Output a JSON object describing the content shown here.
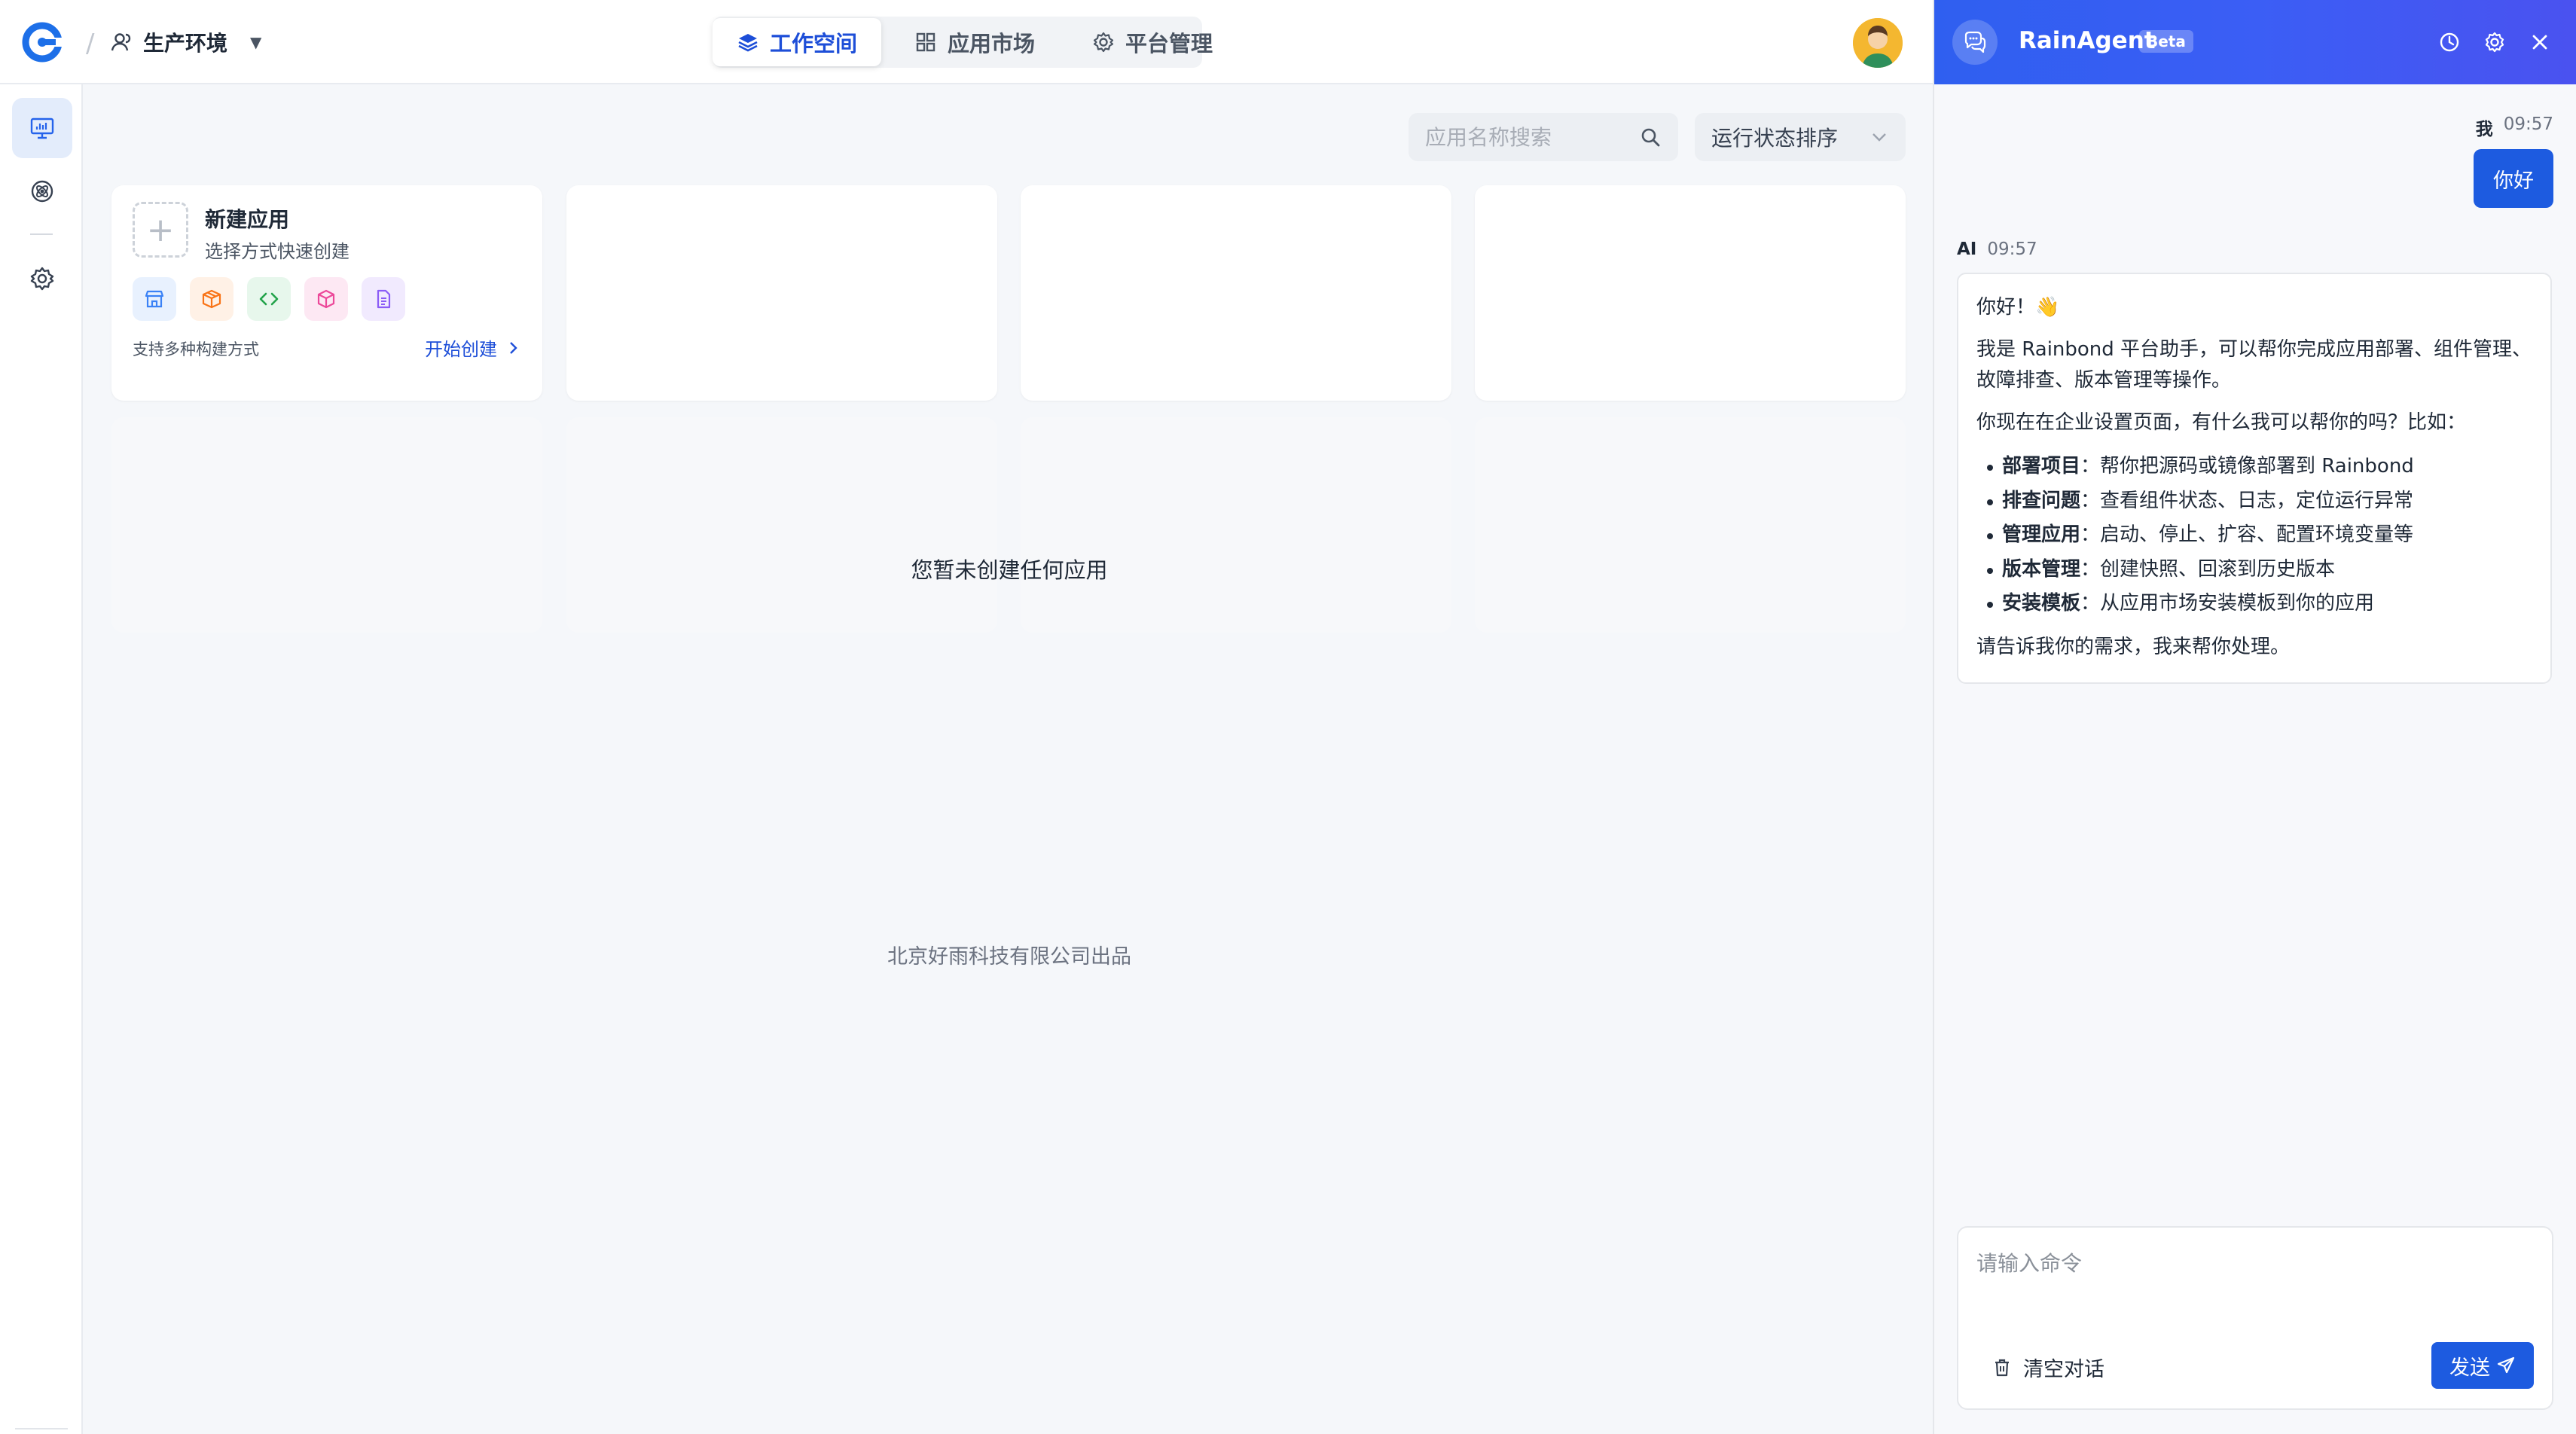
{
  "header": {
    "environment": "生产环境",
    "tabs": [
      {
        "label": "工作空间",
        "icon": "layers-icon",
        "active": true
      },
      {
        "label": "应用市场",
        "icon": "grid-icon",
        "active": false
      },
      {
        "label": "平台管理",
        "icon": "gear-icon",
        "active": false
      }
    ]
  },
  "sidebar": {
    "items": [
      {
        "icon": "monitor-icon",
        "active": true
      },
      {
        "icon": "atom-icon",
        "active": false
      },
      {
        "icon": "settings-icon",
        "active": false
      }
    ]
  },
  "toolbar": {
    "search_placeholder": "应用名称搜索",
    "sort_label": "运行状态排序"
  },
  "new_app_card": {
    "title": "新建应用",
    "subtitle": "选择方式快速创建",
    "support_text": "支持多种构建方式",
    "start_label": "开始创建",
    "build_icons": [
      {
        "icon": "store-icon",
        "color": "#3b82f6",
        "bg": "#e8f1fe"
      },
      {
        "icon": "package-icon",
        "color": "#f97316",
        "bg": "#fff1e6"
      },
      {
        "icon": "code-icon",
        "color": "#22a34a",
        "bg": "#e7f7ec"
      },
      {
        "icon": "cube-icon",
        "color": "#ec4899",
        "bg": "#fde8f3"
      },
      {
        "icon": "document-icon",
        "color": "#8b5cf6",
        "bg": "#f1eafe"
      }
    ]
  },
  "main": {
    "empty_text": "您暂未创建任何应用",
    "footer_text": "北京好雨科技有限公司出品"
  },
  "agent": {
    "name": "RainAgent",
    "badge": "Beta",
    "user_message": {
      "sender": "我",
      "time": "09:57",
      "text": "你好"
    },
    "ai_message": {
      "sender": "AI",
      "time": "09:57",
      "greeting": "你好！👋",
      "intro": "我是 Rainbond 平台助手，可以帮你完成应用部署、组件管理、故障排查、版本管理等操作。",
      "question": "你现在在企业设置页面，有什么我可以帮你的吗？比如：",
      "items": [
        {
          "title": "部署项目",
          "desc": "：帮你把源码或镜像部署到 Rainbond"
        },
        {
          "title": "排查问题",
          "desc": "：查看组件状态、日志，定位运行异常"
        },
        {
          "title": "管理应用",
          "desc": "：启动、停止、扩容、配置环境变量等"
        },
        {
          "title": "版本管理",
          "desc": "：创建快照、回滚到历史版本"
        },
        {
          "title": "安装模板",
          "desc": "：从应用市场安装模板到你的应用"
        }
      ],
      "closing": "请告诉我你的需求，我来帮你处理。"
    },
    "input_placeholder": "请输入命令",
    "clear_label": "清空对话",
    "send_label": "发送"
  }
}
